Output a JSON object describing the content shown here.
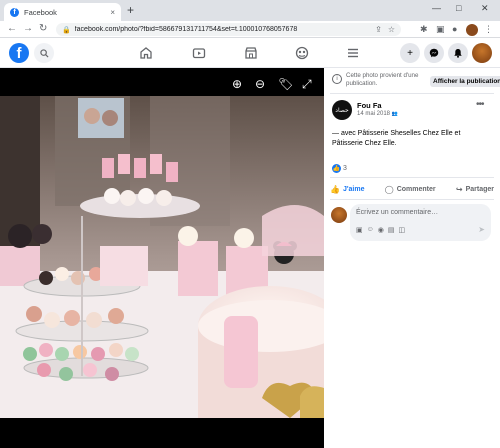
{
  "browser": {
    "tab_title": "Facebook",
    "tab_favicon": "f",
    "new_tab": "+",
    "tab_close": "×",
    "url": "facebook.com/photo/?fbid=586679131711754&set=t.100010768057678",
    "window_controls": {
      "minimize": "—",
      "maximize": "□",
      "close": "✕"
    }
  },
  "fb_header": {
    "logo": "f",
    "search_icon": "🔍",
    "add": "+",
    "badge_color": "#1877f2"
  },
  "viewer": {
    "icons": [
      "zoom-in-icon",
      "zoom-out-icon",
      "tag-icon",
      "fullscreen-icon"
    ]
  },
  "notice": {
    "text": "Cette photo provient d'une publication.",
    "button": "Afficher la publication"
  },
  "post": {
    "author": "Fou Fa",
    "avatar_text": "حصاد",
    "date": "14 mai 2018",
    "audience_icon": "👥",
    "menu": "•••",
    "text": "— avec Pâtisserie Sheselles Chez Elle et Pâtisserie Chez Elle.",
    "like_count": "3",
    "like_icon": "👍"
  },
  "actions": {
    "like": "J'aime",
    "comment": "Commenter",
    "share": "Partager"
  },
  "comment": {
    "placeholder": "Écrivez un commentaire…"
  }
}
